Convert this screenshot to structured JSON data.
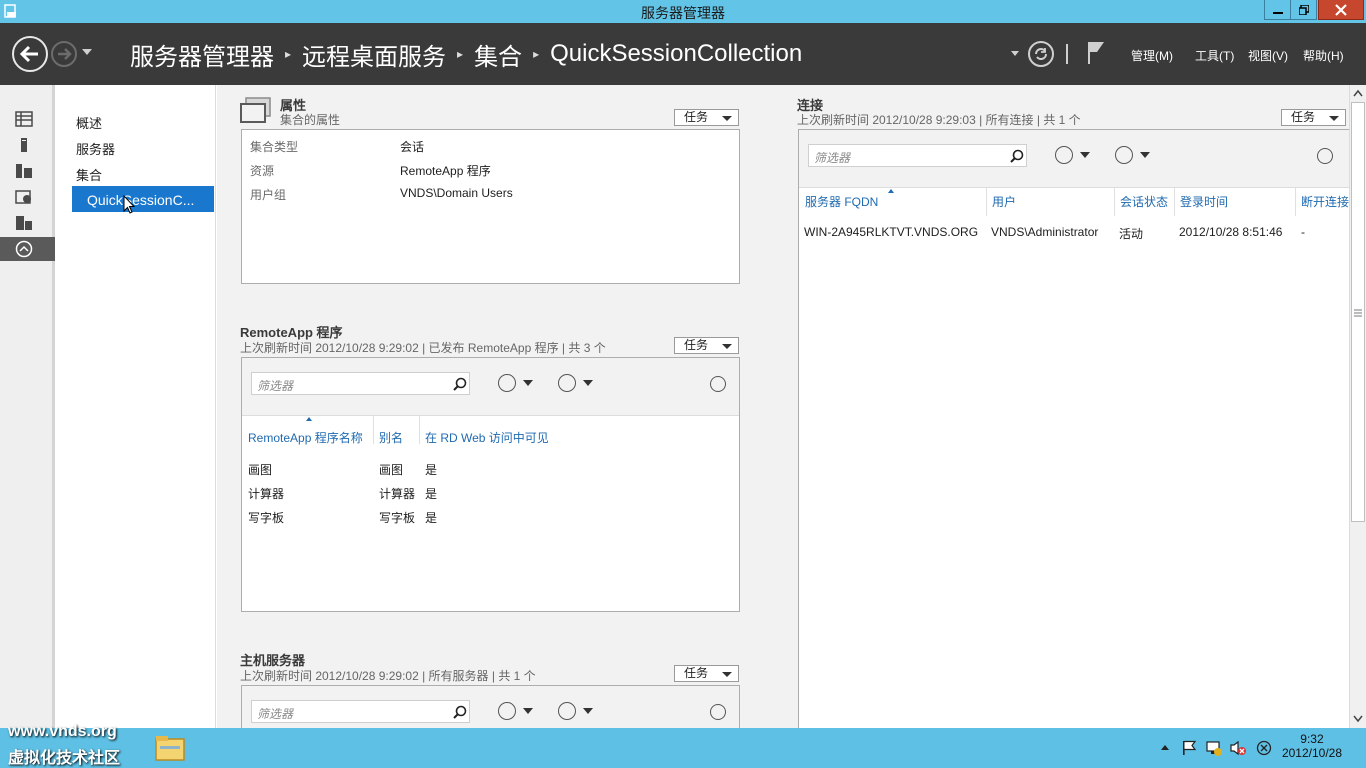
{
  "window": {
    "title": "服务器管理器"
  },
  "breadcrumb": {
    "items": [
      "服务器管理器",
      "远程桌面服务",
      "集合",
      "QuickSessionCollection"
    ]
  },
  "menu": {
    "manage": "管理(M)",
    "tools": "工具(T)",
    "view": "视图(V)",
    "help": "帮助(H)"
  },
  "nav": {
    "items": [
      {
        "label": "概述"
      },
      {
        "label": "服务器"
      },
      {
        "label": "集合"
      },
      {
        "label": "QuickSessionC..."
      }
    ]
  },
  "properties": {
    "title": "属性",
    "subtitle": "集合的属性",
    "task_label": "任务",
    "rows": [
      {
        "label": "集合类型",
        "value": "会话"
      },
      {
        "label": "资源",
        "value": "RemoteApp 程序"
      },
      {
        "label": "用户组",
        "value": "VNDS\\Domain Users"
      }
    ]
  },
  "remoteapp": {
    "title": "RemoteApp 程序",
    "subtitle": "上次刷新时间 2012/10/28 9:29:02 | 已发布 RemoteApp 程序 | 共 3 个",
    "task_label": "任务",
    "filter_placeholder": "筛选器",
    "columns": [
      "RemoteApp 程序名称",
      "别名",
      "在 RD Web 访问中可见"
    ],
    "rows": [
      [
        "画图",
        "画图",
        "是"
      ],
      [
        "计算器",
        "计算器",
        "是"
      ],
      [
        "写字板",
        "写字板",
        "是"
      ]
    ]
  },
  "hosts": {
    "title": "主机服务器",
    "subtitle": "上次刷新时间 2012/10/28 9:29:02 | 所有服务器 | 共 1 个",
    "task_label": "任务",
    "filter_placeholder": "筛选器"
  },
  "connections": {
    "title": "连接",
    "subtitle": "上次刷新时间 2012/10/28 9:29:03 | 所有连接 | 共 1 个",
    "task_label": "任务",
    "filter_placeholder": "筛选器",
    "columns": [
      "服务器 FQDN",
      "用户",
      "会话状态",
      "登录时间",
      "断开连接"
    ],
    "rows": [
      [
        "WIN-2A945RLKTVT.VNDS.ORG",
        "VNDS\\Administrator",
        "活动",
        "2012/10/28 8:51:46",
        "-"
      ]
    ]
  },
  "taskbar": {
    "watermark_line1": "www.vnds.org",
    "watermark_line2": "虚拟化技术社区",
    "time": "9:32",
    "date": "2012/10/28"
  }
}
